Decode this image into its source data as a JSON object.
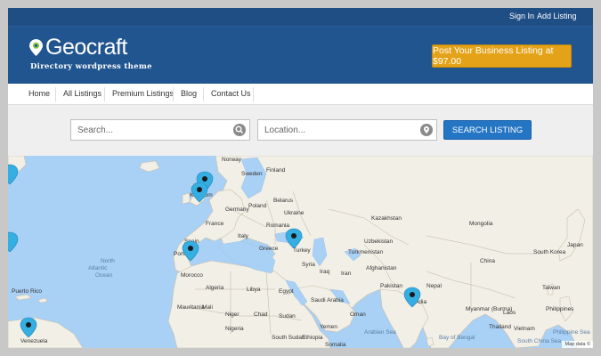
{
  "topbar": {
    "sign_in": "Sign In",
    "add_listing": "Add Listing"
  },
  "brand": {
    "name": "Geocraft",
    "tagline": "Directory wordpress theme"
  },
  "header": {
    "cta_label": "Post Your Business Listing at $97.00"
  },
  "nav": {
    "items": [
      "Home",
      "All Listings",
      "Premium Listings",
      "Blog",
      "Contact Us"
    ]
  },
  "search": {
    "search_placeholder": "Search...",
    "location_placeholder": "Location...",
    "button_label": "SEARCH LISTING"
  },
  "map": {
    "attribution": "Map data ©",
    "labels": {
      "norway": "Norway",
      "sweden": "Sweden",
      "finland": "Finland",
      "kingdom": "Kingdom",
      "belarus": "Belarus",
      "poland": "Poland",
      "germany": "Germany",
      "ukraine": "Ukraine",
      "france": "France",
      "italy": "Italy",
      "spain": "Spain",
      "portugal": "Portu",
      "romania": "Romania",
      "greece": "Greece",
      "turkey": "Turkey",
      "syria": "Syria",
      "iraq": "Iraq",
      "iran": "Iran",
      "kazakhstan": "Kazakhstan",
      "uzbekistan": "Uzbekistan",
      "turkmenistan": "Turkmenistan",
      "afghanistan": "Afghanistan",
      "pakistan": "Pakistan",
      "india": "India",
      "china": "China",
      "mongolia": "Mongolia",
      "nepal": "Nepal",
      "myanmar": "Myanmar (Burma)",
      "thailand": "Thailand",
      "philippines": "Philippines",
      "morocco": "Morocco",
      "algeria": "Algeria",
      "libya": "Libya",
      "egypt": "Egypt",
      "saudi": "Saudi Arabia",
      "oman": "Oman",
      "yemen": "Yemen",
      "mauritania": "Mauritania",
      "mali": "Mali",
      "niger": "Niger",
      "chad": "Chad",
      "sudan": "Sudan",
      "nigeria": "Nigeria",
      "ethiopia": "Ethiopia",
      "somalia": "Somalia",
      "south_sudan": "South Sudan",
      "puerto_rico": "Puerto Rico",
      "venezuela": "Venezuela",
      "north": "North",
      "atlantic": "Atlantic",
      "ocean": "Ocean",
      "arabian_sea": "Arabian Sea",
      "bay_of_bengal": "Bay of Bengal",
      "south_china_sea": "South China Sea",
      "philippine_sea": "Philippine Sea",
      "japan": "Japan",
      "south_korea": "South Korea",
      "taiwan": "Taiwan",
      "laos": "Laos",
      "vietnam": "Vietnam"
    }
  },
  "colors": {
    "topbar": "#1f4e85",
    "header": "#21558f",
    "cta": "#e3a217",
    "search_button": "#2475c4",
    "pin": "#35aee2"
  }
}
